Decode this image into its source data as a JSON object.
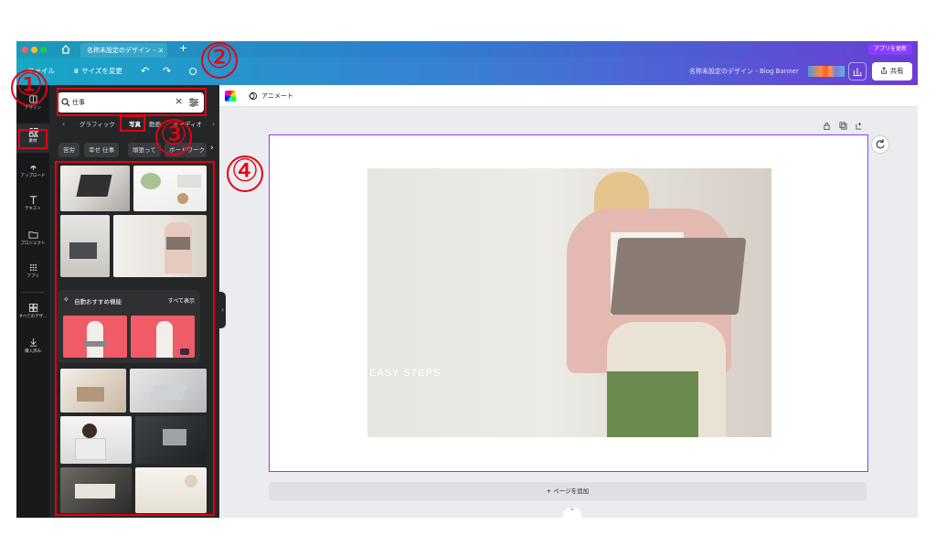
{
  "tabbar": {
    "tab_title": "名称未設定のデザイン - ...",
    "close_label": "×",
    "new_tab_label": "+",
    "update_label": "アプリを更新"
  },
  "toolbar": {
    "file_label": "ファイル",
    "resize_label": "♛ サイズを変更",
    "undo_label": "↶",
    "redo_label": "↷",
    "doc_title": "名称未設定のデザイン - Blog Banner",
    "share_label": "共有"
  },
  "rail": {
    "items": [
      {
        "label": "デザイン",
        "icon": "template-icon"
      },
      {
        "label": "素材",
        "icon": "elements-icon"
      },
      {
        "label": "アップロード",
        "icon": "upload-icon"
      },
      {
        "label": "テキスト",
        "icon": "text-icon"
      },
      {
        "label": "プロジェクト",
        "icon": "folder-icon"
      },
      {
        "label": "アプリ",
        "icon": "apps-icon"
      },
      {
        "label": "すべてのデザ...",
        "icon": "grid-icon"
      },
      {
        "label": "購入済み",
        "icon": "download-icon"
      }
    ]
  },
  "panel": {
    "search_value": "仕事",
    "search_clear": "×",
    "tabs": [
      "グラフィック",
      "写真",
      "動画",
      "オーディオ"
    ],
    "tags": [
      "苦労",
      "幸せ 仕事",
      "頑張って",
      "ボードワーク"
    ],
    "suggest_title": "自動おすすめ機能",
    "suggest_link": "すべて表示"
  },
  "subbar": {
    "animate_label": "アニメート"
  },
  "stage": {
    "overlay_text": "EASY STEPS"
  },
  "addpage_label": "+ ページを追加",
  "annotations": [
    "①",
    "②",
    "③",
    "④"
  ],
  "colors": {
    "accent": "#8b3dff",
    "annotation_red": "#e60012",
    "panel_bg": "#252627",
    "rail_bg": "#18191b"
  }
}
